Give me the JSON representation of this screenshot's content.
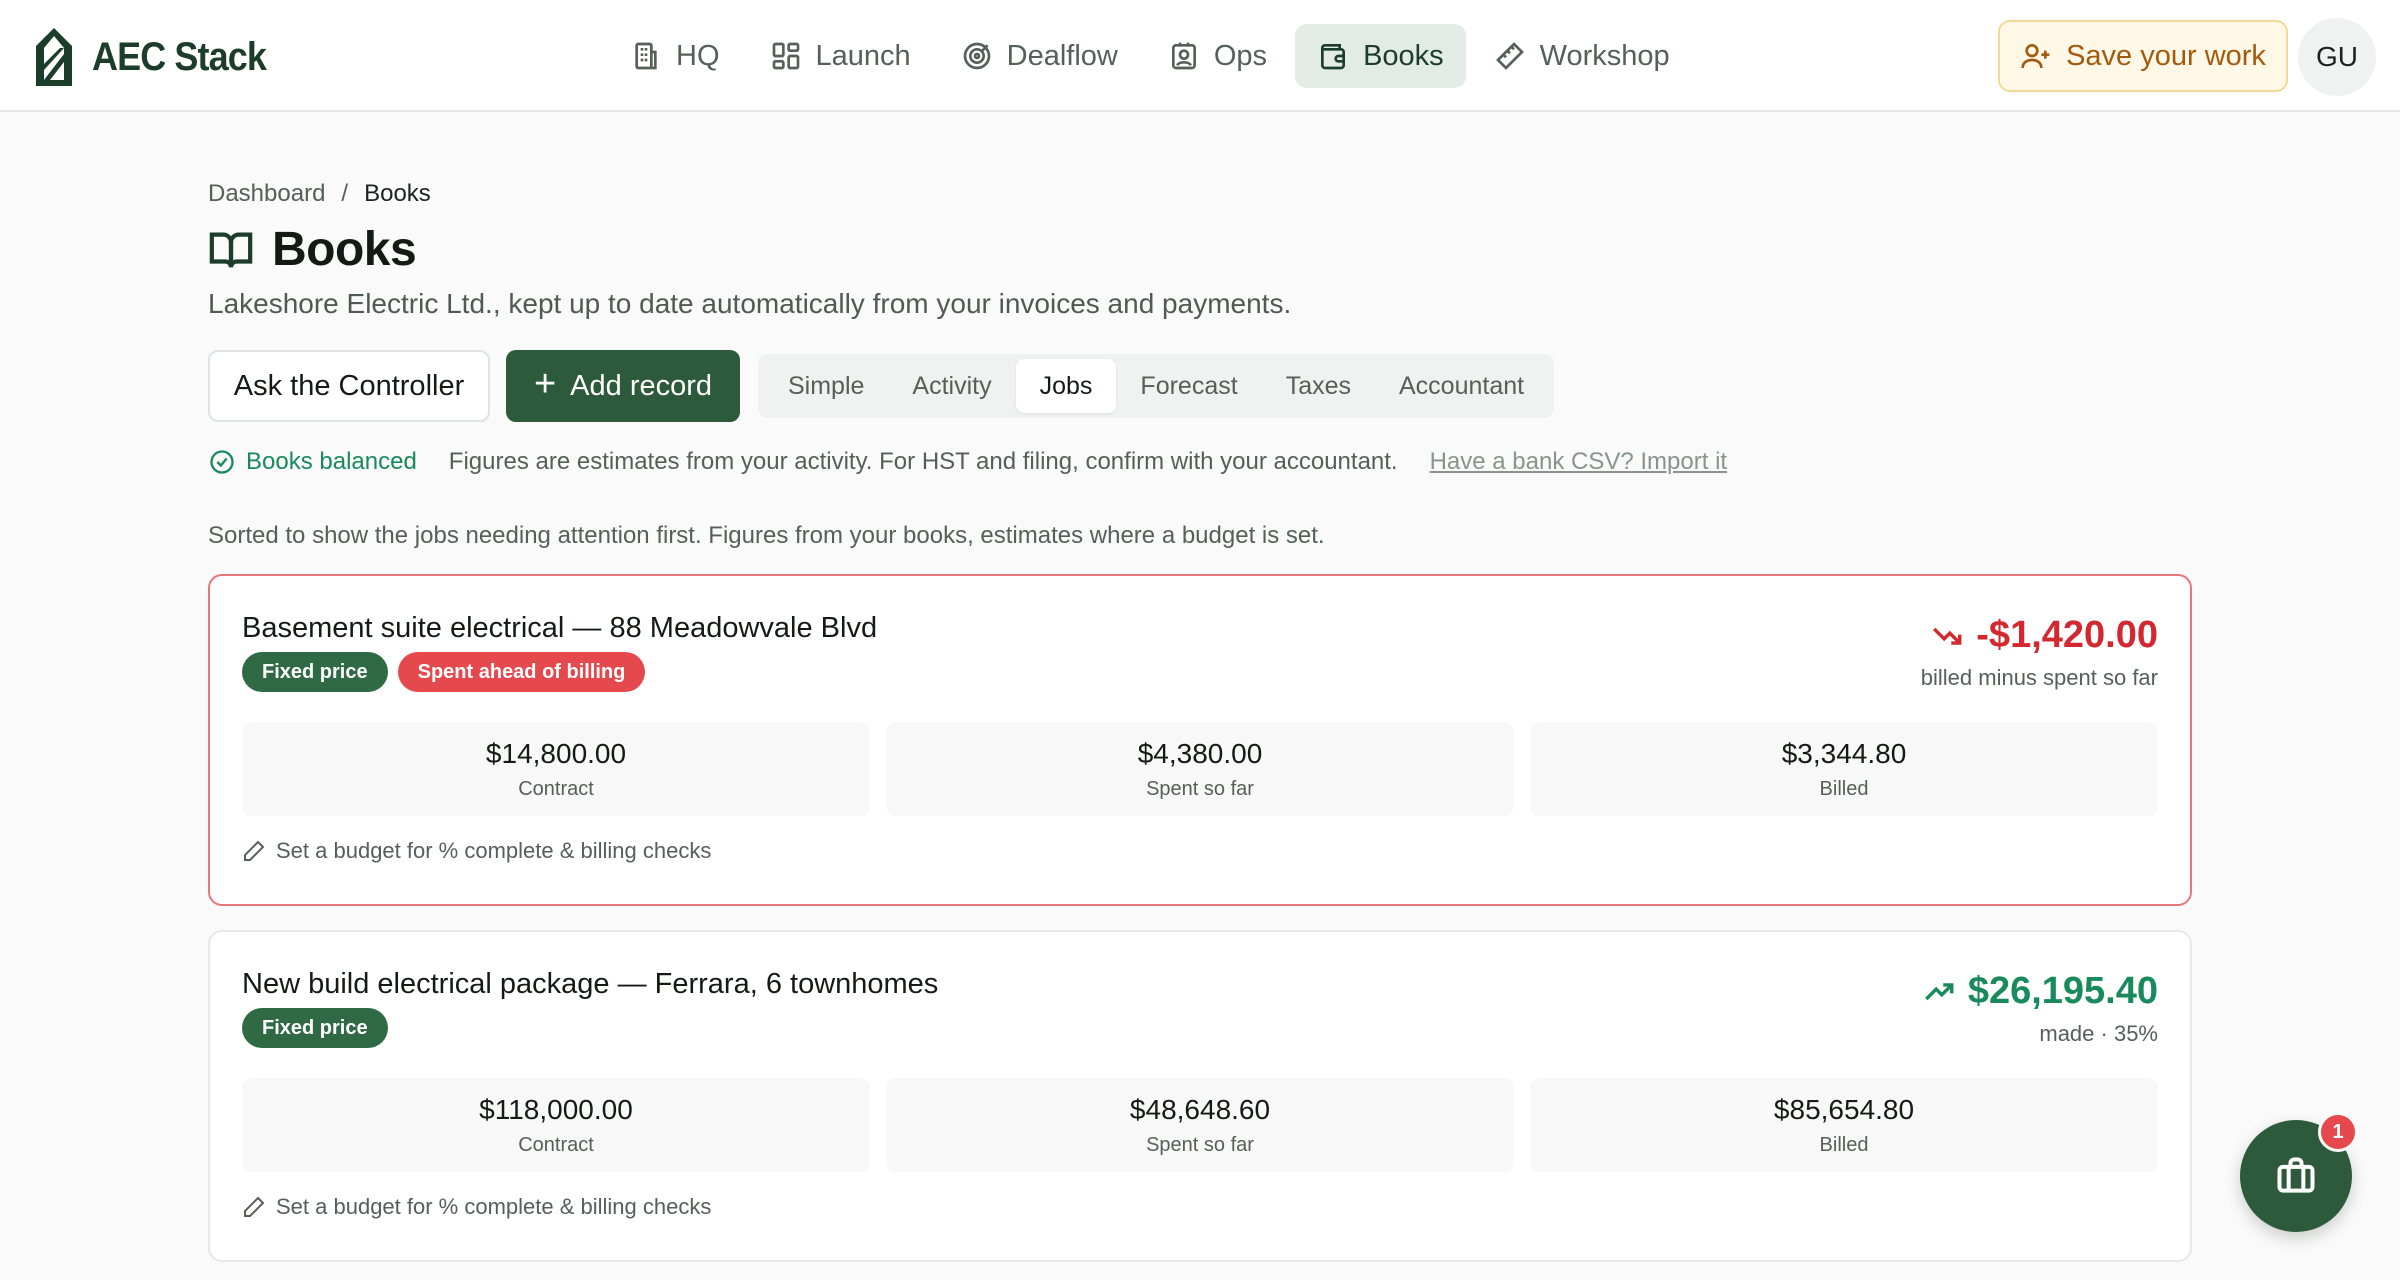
{
  "brand": {
    "name": "AEC Stack"
  },
  "nav": {
    "items": [
      {
        "label": "HQ",
        "icon": "building-icon"
      },
      {
        "label": "Launch",
        "icon": "grid-icon"
      },
      {
        "label": "Dealflow",
        "icon": "target-icon"
      },
      {
        "label": "Ops",
        "icon": "badge-icon"
      },
      {
        "label": "Books",
        "icon": "wallet-icon",
        "active": true
      },
      {
        "label": "Workshop",
        "icon": "ruler-icon"
      }
    ],
    "save_label": "Save your work",
    "avatar_initials": "GU"
  },
  "breadcrumb": {
    "root": "Dashboard",
    "separator": "/",
    "current": "Books"
  },
  "page": {
    "title": "Books",
    "subtitle": "Lakeshore Electric Ltd., kept up to date automatically from your invoices and payments."
  },
  "actions": {
    "ask_label": "Ask the Controller",
    "add_label": "Add record"
  },
  "tabs": [
    {
      "label": "Simple"
    },
    {
      "label": "Activity"
    },
    {
      "label": "Jobs",
      "active": true
    },
    {
      "label": "Forecast"
    },
    {
      "label": "Taxes"
    },
    {
      "label": "Accountant"
    }
  ],
  "status": {
    "balanced_label": "Books balanced",
    "disclaimer": "Figures are estimates from your activity. For HST and filing, confirm with your accountant.",
    "csv_link": "Have a bank CSV? Import it"
  },
  "sorted_note": "Sorted to show the jobs needing attention first. Figures from your books, estimates where a budget is set.",
  "jobs": [
    {
      "title": "Basement suite electrical — 88 Meadowvale Blvd",
      "badges": [
        "Fixed price",
        "Spent ahead of billing"
      ],
      "amount": "-$1,420.00",
      "amount_caption": "billed minus spent so far",
      "contract": "$14,800.00",
      "contract_label": "Contract",
      "spent": "$4,380.00",
      "spent_label": "Spent so far",
      "billed": "$3,344.80",
      "billed_label": "Billed",
      "budget_link": "Set a budget for % complete & billing checks"
    },
    {
      "title": "New build electrical package — Ferrara, 6 townhomes",
      "badges": [
        "Fixed price"
      ],
      "amount": "$26,195.40",
      "amount_caption": "made · 35%",
      "contract": "$118,000.00",
      "contract_label": "Contract",
      "spent": "$48,648.60",
      "spent_label": "Spent so far",
      "billed": "$85,654.80",
      "billed_label": "Billed",
      "budget_link": "Set a budget for % complete & billing checks"
    }
  ],
  "fab": {
    "notification_count": "1",
    "icon": "briefcase-icon"
  },
  "colors": {
    "brand_green": "#2c5a3b",
    "danger": "#d3282f",
    "success": "#188a5c",
    "warning_text": "#a45a0c"
  }
}
